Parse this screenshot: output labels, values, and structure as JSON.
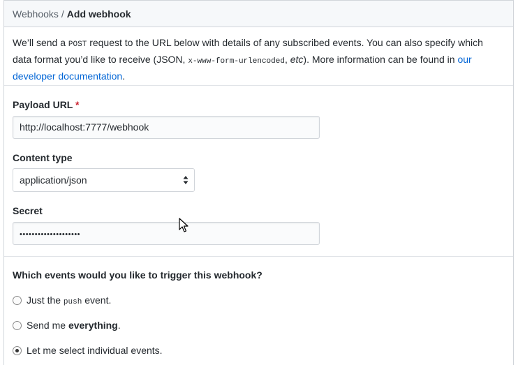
{
  "header": {
    "parent_crumb": "Webhooks",
    "separator": "/",
    "current_crumb": "Add webhook"
  },
  "intro": {
    "part1": "We’ll send a ",
    "code1": "POST",
    "part2": " request to the URL below with details of any subscribed events. You can also specify which data format you’d like to receive (JSON, ",
    "code2": "x-www-form-urlencoded",
    "part3": ", ",
    "em1": "etc",
    "part4": "). More information can be found in ",
    "link_text": "our developer documentation",
    "part5": "."
  },
  "form": {
    "payload_url": {
      "label": "Payload URL",
      "required_marker": "*",
      "value": "http://localhost:7777/webhook"
    },
    "content_type": {
      "label": "Content type",
      "selected": "application/json"
    },
    "secret": {
      "label": "Secret",
      "masked_value": "••••••••••••••••••••"
    }
  },
  "events": {
    "question": "Which events would you like to trigger this webhook?",
    "options": [
      {
        "prefix": "Just the ",
        "code": "push",
        "suffix": " event.",
        "checked": false
      },
      {
        "prefix": "Send me ",
        "bold": "everything",
        "suffix": ".",
        "checked": false
      },
      {
        "text": "Let me select individual events.",
        "checked": true
      }
    ]
  },
  "colors": {
    "link": "#0366d6",
    "required": "#cb2431",
    "header_bg": "#f6f8fa",
    "border": "#d1d5da"
  }
}
